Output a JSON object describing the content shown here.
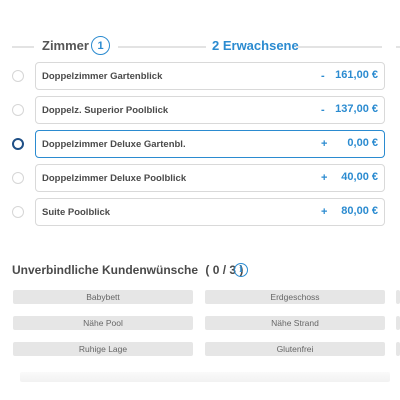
{
  "header": {
    "rooms_label": "Zimmer",
    "rooms_count": "1",
    "guests_label": "2 Erwachsene"
  },
  "rooms": [
    {
      "name": "Doppelzimmer Gartenblick",
      "sign": "-",
      "price": "161,00 €",
      "selected": false
    },
    {
      "name": "Doppelz. Superior Poolblick",
      "sign": "-",
      "price": "137,00 €",
      "selected": false
    },
    {
      "name": "Doppelzimmer Deluxe Gartenbl.",
      "sign": "+",
      "price": "0,00 €",
      "selected": true
    },
    {
      "name": "Doppelzimmer Deluxe Poolblick",
      "sign": "+",
      "price": "40,00 €",
      "selected": false
    },
    {
      "name": "Suite Poolblick",
      "sign": "+",
      "price": "80,00 €",
      "selected": false
    }
  ],
  "wishes": {
    "title": "Unverbindliche Kundenwünsche",
    "count": "( 0 / 3 )",
    "info_icon": "info-icon",
    "options": [
      [
        "Babybett",
        "Erdgeschoss"
      ],
      [
        "Nähe Pool",
        "Nähe Strand"
      ],
      [
        "Ruhige Lage",
        "Glutenfrei"
      ]
    ]
  },
  "colors": {
    "accent": "#2b8bd0",
    "selected_radio": "#1f4f86",
    "chip_bg": "#e6e6e6"
  }
}
